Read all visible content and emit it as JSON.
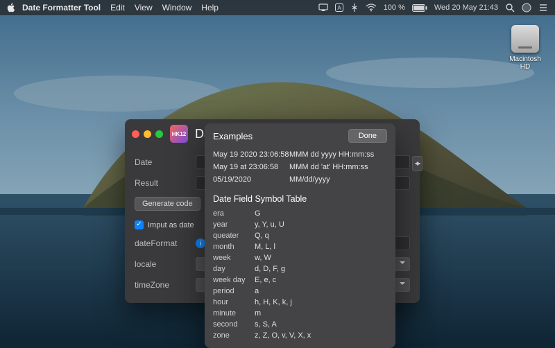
{
  "menubar": {
    "app": "Date Formatter Tool",
    "items": [
      "Edit",
      "View",
      "Window",
      "Help"
    ],
    "battery": "100 %",
    "clock": "Wed 20 May  21:43"
  },
  "desktop": {
    "drive_label": "Macintosh HD"
  },
  "window": {
    "title": "Date",
    "labels": {
      "date": "Date",
      "result": "Result",
      "dateFormat": "dateFormat",
      "locale": "locale",
      "timeZone": "timeZone"
    },
    "generate_btn": "Generate code",
    "checkbox_label": "Imput as date"
  },
  "popover": {
    "examples_title": "Examples",
    "done": "Done",
    "examples": [
      {
        "sample": "May 19 2020 23:06:58",
        "pattern": "MMM dd yyyy HH:mm:ss"
      },
      {
        "sample": "May 19 at 23:06:58",
        "pattern": "MMM dd 'at' HH:mm:ss"
      },
      {
        "sample": "05/19/2020",
        "pattern": "MM/dd/yyyy"
      }
    ],
    "symbol_title": "Date Field Symbol Table",
    "symbols": [
      {
        "name": "era",
        "codes": "G"
      },
      {
        "name": "year",
        "codes": "y, Y, u, U"
      },
      {
        "name": "queater",
        "codes": "Q, q"
      },
      {
        "name": "month",
        "codes": "M, L, l"
      },
      {
        "name": "week",
        "codes": "w, W"
      },
      {
        "name": "day",
        "codes": "d, D, F, g"
      },
      {
        "name": "week day",
        "codes": "E, e, c"
      },
      {
        "name": "period",
        "codes": "a"
      },
      {
        "name": "hour",
        "codes": "h, H, K, k, j"
      },
      {
        "name": "minute",
        "codes": "m"
      },
      {
        "name": "second",
        "codes": "s, S, A"
      },
      {
        "name": "zone",
        "codes": "z, Z, O, v, V, X, x"
      }
    ]
  }
}
